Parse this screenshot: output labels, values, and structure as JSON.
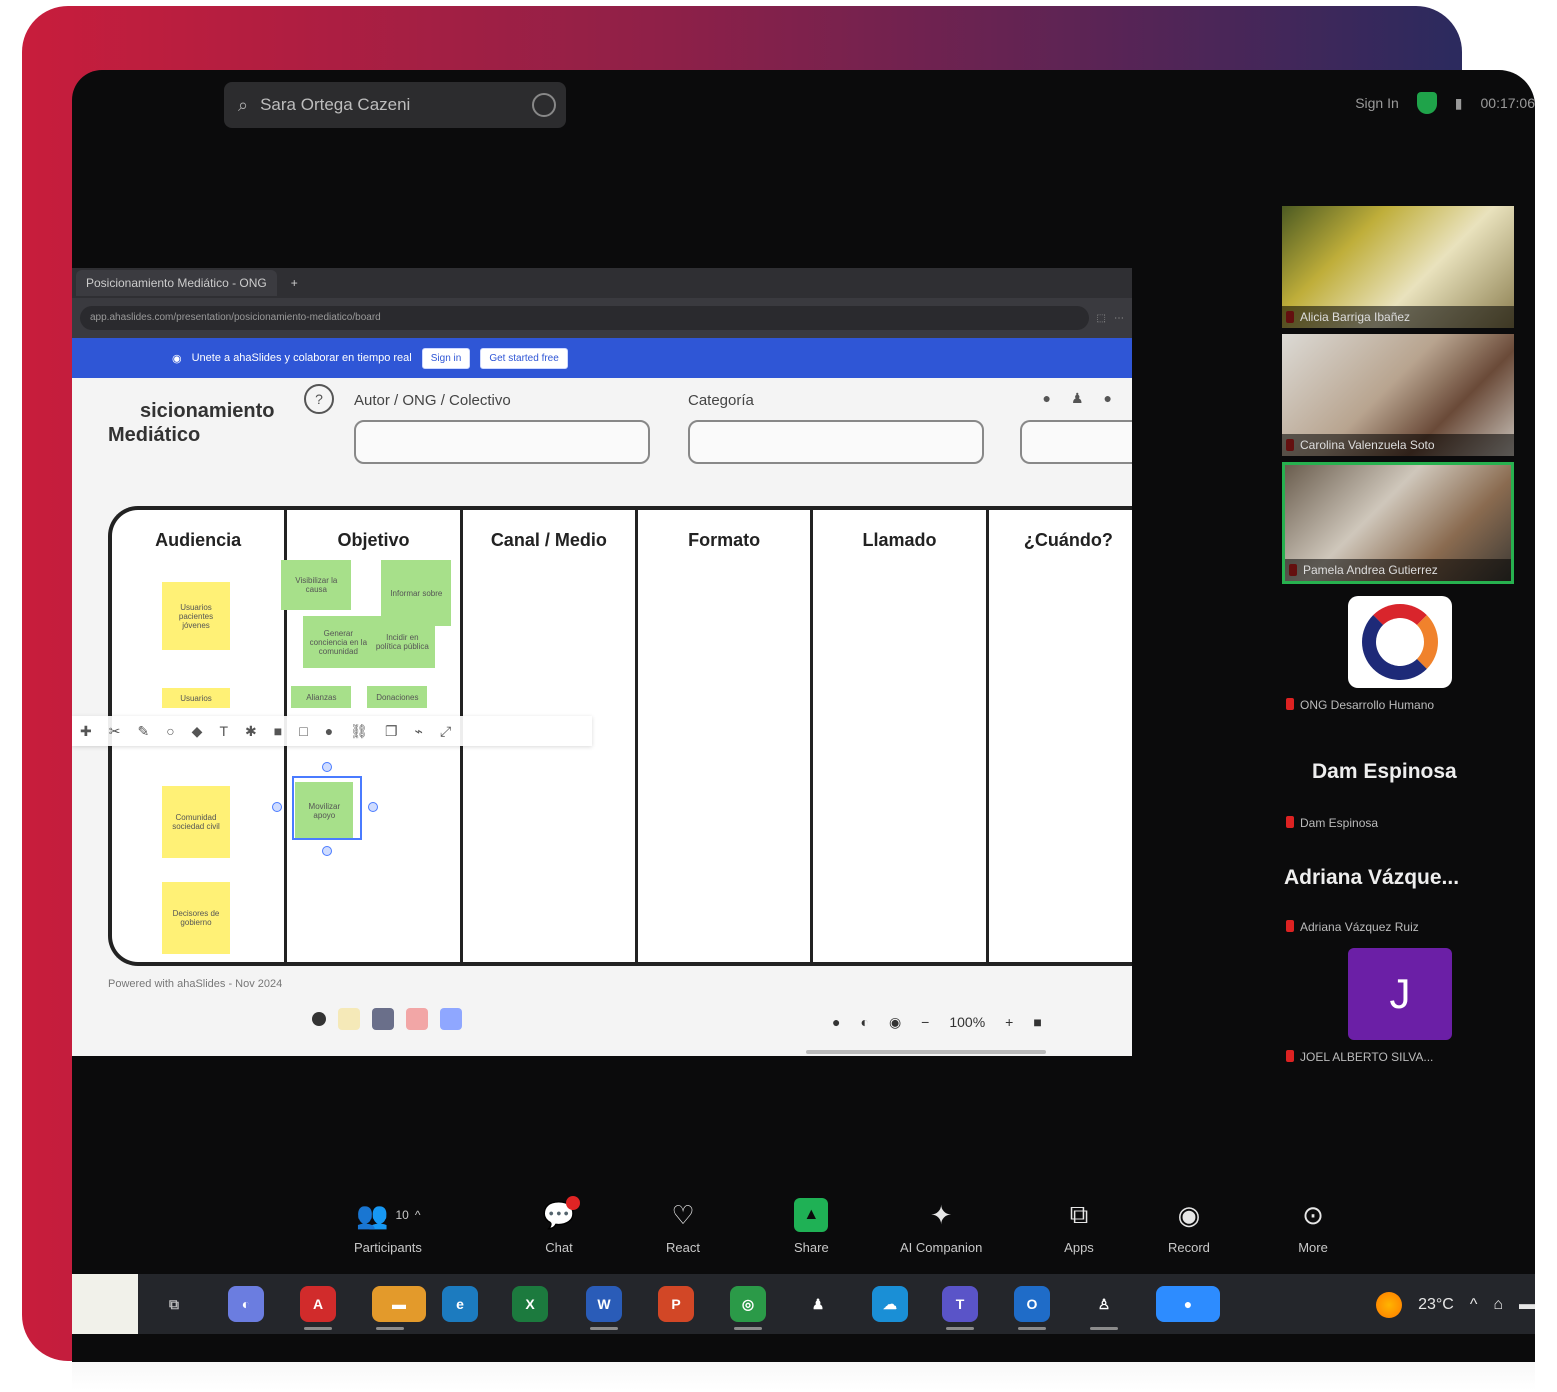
{
  "zoom": {
    "search_text": "Sara Ortega Cazeni",
    "sign_in": "Sign In",
    "status_text": "00:17:06"
  },
  "browser": {
    "tab_label": "Posicionamiento Mediático - ONG",
    "url": "app.ahaslides.com/presentation/posicionamiento-mediatico/board",
    "banner_text": "Unete a ahaSlides y colaborar en tiempo real",
    "banner_btn1": "Sign in",
    "banner_btn2": "Get started free"
  },
  "board": {
    "title_line1": "sicionamiento",
    "title_line2": "Mediático",
    "help": "?",
    "field1_label": "Autor / ONG / Colectivo",
    "field2_label": "Categoría",
    "columns": [
      "Audiencia",
      "Objetivo",
      "Canal / Medio",
      "Formato",
      "Llamado",
      "¿Cuándo?"
    ],
    "notes_yellow": [
      "Usuarios pacientes jóvenes",
      "Usuarios",
      "Comunidad sociedad civil",
      "Decisores de gobierno"
    ],
    "notes_green": [
      "Visibilizar la causa",
      "Informar sobre",
      "Generar conciencia en la comunidad",
      "Incidir en política pública",
      "Alianzas",
      "Donaciones",
      "Movilizar apoyo"
    ],
    "footer_text": "Powered with ahaSlides - Nov 2024",
    "zoom_level": "100%"
  },
  "participants": [
    {
      "name": "Alicia Barriga Ibañez"
    },
    {
      "name": "Carolina Valenzuela Soto"
    },
    {
      "name": "Pamela Andrea Gutierrez"
    },
    {
      "name": "ONG Desarrollo Humano"
    },
    {
      "display": "Dam Espinosa",
      "name": "Dam Espinosa"
    },
    {
      "display": "Adriana Vázque...",
      "name": "Adriana Vázquez Ruiz"
    },
    {
      "initial": "J",
      "name": "JOEL ALBERTO SILVA..."
    }
  ],
  "toolbar": {
    "participants": "Participants",
    "participants_count": "10",
    "chat": "Chat",
    "react": "React",
    "share": "Share",
    "ai": "AI Companion",
    "apps": "Apps",
    "record": "Record",
    "more": "More"
  },
  "taskbar": {
    "temperature": "23°C"
  },
  "colors": {
    "frame_start": "#c81d3c",
    "frame_end": "#2b2a5e",
    "banner": "#2f56d6",
    "note_yellow": "#fff176",
    "note_green": "#a7e08a",
    "active_speaker": "#27b14f",
    "share_green": "#1fb155",
    "avatar_purple": "#6b1fa6"
  }
}
